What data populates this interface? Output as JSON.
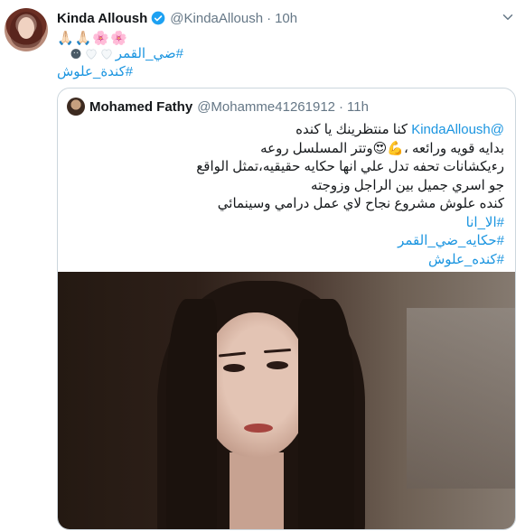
{
  "tweet": {
    "author_name": "Kinda Alloush",
    "author_handle": "@KindaAlloush",
    "separator": "·",
    "time": "10h",
    "emojis": "🙏🏻🙏🏻🌸🌸",
    "hashtag1": "#ضي_القمر",
    "hashtag2": "#كندة_علوش",
    "icons": [
      "verified-badge-icon",
      "white-heart-icon",
      "white-heart-icon",
      "dark-round-emoji-icon",
      "caret-down-icon"
    ]
  },
  "quoted": {
    "author_name": "Mohamed Fathy",
    "author_handle": "@Mohamme41261912",
    "separator": "·",
    "time": "11h",
    "line1_mention": "@KindaAlloush",
    "line1_text": "كنا منتظرينك يا كنده",
    "line2": "بدايه قويه ورائعه ،💪😍وتتر المسلسل روعه",
    "line3": "رءيكشانات تحفه تدل علي انها حكايه حقيقيه،تمثل الواقع",
    "line4": "جو اسري جميل بين الراجل وزوجته",
    "line5": "كنده علوش مشروع نجاح لاي عمل درامي وسينمائي",
    "tag1": "#الا_انا",
    "tag2": "#حكايه_ضي_القمر",
    "tag3": "#كنده_علوش"
  },
  "colors": {
    "link": "#1b95e0",
    "muted": "#657786",
    "border": "#ccd6dd",
    "text": "#14171a"
  }
}
